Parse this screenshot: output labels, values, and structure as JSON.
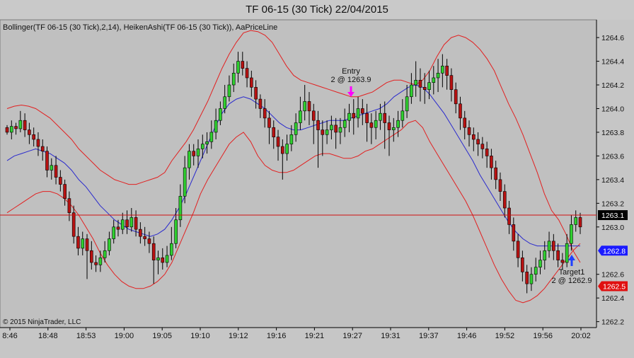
{
  "window_title": "TF 06-15 (30 Tick)  22/04/2015",
  "indicator_legend": "Bollinger(TF 06-15 (30 Tick),2,14), HeikenAshi(TF 06-15 (30 Tick)), AaPriceLine",
  "copyright": "© 2015 NinjaTrader, LLC",
  "colors": {
    "background": "#c0c0c0",
    "candle_up": "#2fcf2f",
    "candle_down": "#b81212",
    "bollinger_band": "#e22020",
    "bollinger_mid": "#2a2acd",
    "price_line": "#d01010",
    "entry_marker": "#ff00ff",
    "target_marker": "#2040ff"
  },
  "chart_data": {
    "type": "candlestick",
    "title": "TF 06-15 (30 Tick)  22/04/2015",
    "ylim": [
      1262.15,
      1264.75
    ],
    "y_ticks": [
      "1264.6",
      "1264.4",
      "1264.2",
      "1264.0",
      "1263.8",
      "1263.6",
      "1263.4",
      "1263.2",
      "1263.0",
      "1262.6",
      "1262.4",
      "1262.2"
    ],
    "x_ticks": [
      "8:46",
      "18:48",
      "18:53",
      "19:00",
      "19:05",
      "19:10",
      "19:12",
      "19:16",
      "19:21",
      "19:27",
      "19:31",
      "19:37",
      "19:46",
      "19:52",
      "19:56",
      "20:02"
    ],
    "price_line": {
      "value": 1263.1,
      "label": "1263.1"
    },
    "price_markers": [
      {
        "label": "1262.8",
        "value": 1262.8,
        "color": "#1a1aff"
      },
      {
        "label": "1262.5",
        "value": 1262.5,
        "color": "#e01010"
      }
    ],
    "annotations": [
      {
        "name": "Entry",
        "text": "2 @ 1263.9",
        "x": "19:27",
        "price": 1263.9
      },
      {
        "name": "Target1",
        "text": "2 @ 1262.9",
        "x": "20:01",
        "price": 1262.9
      }
    ],
    "candles": [
      [
        1263.84,
        1263.8,
        1263.78,
        1263.86
      ],
      [
        1263.8,
        1263.85,
        1263.74,
        1263.9
      ],
      [
        1263.85,
        1263.83,
        1263.78,
        1263.88
      ],
      [
        1263.83,
        1263.9,
        1263.8,
        1263.98
      ],
      [
        1263.9,
        1263.82,
        1263.76,
        1263.96
      ],
      [
        1263.82,
        1263.78,
        1263.7,
        1263.88
      ],
      [
        1263.78,
        1263.74,
        1263.68,
        1263.84
      ],
      [
        1263.74,
        1263.68,
        1263.6,
        1263.8
      ],
      [
        1263.68,
        1263.64,
        1263.56,
        1263.74
      ],
      [
        1263.64,
        1263.48,
        1263.42,
        1263.68
      ],
      [
        1263.48,
        1263.52,
        1263.4,
        1263.58
      ],
      [
        1263.52,
        1263.42,
        1263.36,
        1263.6
      ],
      [
        1263.42,
        1263.36,
        1263.3,
        1263.48
      ],
      [
        1263.36,
        1263.24,
        1263.18,
        1263.4
      ],
      [
        1263.24,
        1263.12,
        1263.05,
        1263.3
      ],
      [
        1263.12,
        1262.92,
        1262.86,
        1263.18
      ],
      [
        1262.92,
        1262.82,
        1262.76,
        1263.0
      ],
      [
        1262.82,
        1262.9,
        1262.76,
        1262.96
      ],
      [
        1262.9,
        1262.8,
        1262.56,
        1262.94
      ],
      [
        1262.8,
        1262.7,
        1262.64,
        1262.88
      ],
      [
        1262.7,
        1262.68,
        1262.62,
        1262.76
      ],
      [
        1262.68,
        1262.74,
        1262.62,
        1262.8
      ],
      [
        1262.74,
        1262.8,
        1262.7,
        1262.88
      ],
      [
        1262.8,
        1262.9,
        1262.76,
        1262.96
      ],
      [
        1262.9,
        1263.0,
        1262.86,
        1263.06
      ],
      [
        1263.0,
        1262.98,
        1262.92,
        1263.06
      ],
      [
        1262.98,
        1263.06,
        1262.94,
        1263.12
      ],
      [
        1263.06,
        1263.0,
        1262.94,
        1263.14
      ],
      [
        1263.0,
        1263.08,
        1262.96,
        1263.16
      ],
      [
        1263.08,
        1262.98,
        1262.92,
        1263.14
      ],
      [
        1262.98,
        1262.92,
        1262.86,
        1263.04
      ],
      [
        1262.92,
        1262.9,
        1262.84,
        1263.0
      ],
      [
        1262.9,
        1262.86,
        1262.78,
        1262.96
      ],
      [
        1262.86,
        1262.72,
        1262.52,
        1262.92
      ],
      [
        1262.72,
        1262.74,
        1262.6,
        1262.8
      ],
      [
        1262.74,
        1262.7,
        1262.64,
        1262.82
      ],
      [
        1262.7,
        1262.76,
        1262.66,
        1262.84
      ],
      [
        1262.76,
        1262.86,
        1262.72,
        1263.0
      ],
      [
        1262.86,
        1263.06,
        1262.82,
        1263.16
      ],
      [
        1263.06,
        1263.26,
        1263.0,
        1263.36
      ],
      [
        1263.26,
        1263.5,
        1263.2,
        1263.6
      ],
      [
        1263.5,
        1263.64,
        1263.4,
        1263.7
      ],
      [
        1263.64,
        1263.6,
        1263.52,
        1263.7
      ],
      [
        1263.6,
        1263.66,
        1263.5,
        1263.74
      ],
      [
        1263.66,
        1263.7,
        1263.58,
        1263.78
      ],
      [
        1263.7,
        1263.72,
        1263.62,
        1263.8
      ],
      [
        1263.72,
        1263.8,
        1263.66,
        1263.9
      ],
      [
        1263.8,
        1263.9,
        1263.74,
        1264.0
      ],
      [
        1263.9,
        1264.0,
        1263.86,
        1264.06
      ],
      [
        1264.0,
        1264.1,
        1263.96,
        1264.2
      ],
      [
        1264.1,
        1264.2,
        1264.06,
        1264.28
      ],
      [
        1264.2,
        1264.3,
        1264.14,
        1264.38
      ],
      [
        1264.3,
        1264.4,
        1264.22,
        1264.48
      ],
      [
        1264.4,
        1264.34,
        1264.28,
        1264.48
      ],
      [
        1264.34,
        1264.26,
        1264.18,
        1264.4
      ],
      [
        1264.26,
        1264.18,
        1264.1,
        1264.32
      ],
      [
        1264.18,
        1264.08,
        1264.0,
        1264.24
      ],
      [
        1264.08,
        1264.0,
        1263.92,
        1264.12
      ],
      [
        1264.0,
        1263.92,
        1263.84,
        1264.08
      ],
      [
        1263.92,
        1263.84,
        1263.7,
        1263.98
      ],
      [
        1263.84,
        1263.76,
        1263.66,
        1263.9
      ],
      [
        1263.76,
        1263.68,
        1263.56,
        1263.82
      ],
      [
        1263.68,
        1263.62,
        1263.4,
        1263.74
      ],
      [
        1263.62,
        1263.7,
        1263.56,
        1263.78
      ],
      [
        1263.7,
        1263.78,
        1263.64,
        1263.86
      ],
      [
        1263.78,
        1263.88,
        1263.72,
        1263.96
      ],
      [
        1263.88,
        1263.98,
        1263.82,
        1264.1
      ],
      [
        1263.98,
        1264.06,
        1263.9,
        1264.2
      ],
      [
        1264.06,
        1263.98,
        1263.86,
        1264.14
      ],
      [
        1263.98,
        1263.9,
        1263.7,
        1264.04
      ],
      [
        1263.9,
        1263.82,
        1263.5,
        1263.98
      ],
      [
        1263.82,
        1263.78,
        1263.6,
        1263.9
      ],
      [
        1263.78,
        1263.82,
        1263.7,
        1263.9
      ],
      [
        1263.82,
        1263.86,
        1263.74,
        1263.94
      ],
      [
        1263.86,
        1263.8,
        1263.66,
        1263.92
      ],
      [
        1263.8,
        1263.84,
        1263.7,
        1263.92
      ],
      [
        1263.84,
        1263.9,
        1263.76,
        1264.0
      ],
      [
        1263.9,
        1263.96,
        1263.8,
        1264.04
      ],
      [
        1263.96,
        1263.92,
        1263.78,
        1264.08
      ],
      [
        1263.92,
        1264.0,
        1263.84,
        1264.1
      ],
      [
        1264.0,
        1263.96,
        1263.86,
        1264.08
      ],
      [
        1263.96,
        1263.88,
        1263.72,
        1264.04
      ],
      [
        1263.88,
        1263.84,
        1263.7,
        1263.96
      ],
      [
        1263.84,
        1263.9,
        1263.74,
        1263.98
      ],
      [
        1263.9,
        1263.96,
        1263.82,
        1264.04
      ],
      [
        1263.96,
        1263.88,
        1263.66,
        1264.06
      ],
      [
        1263.88,
        1263.82,
        1263.6,
        1263.94
      ],
      [
        1263.82,
        1263.84,
        1263.72,
        1263.92
      ],
      [
        1263.84,
        1263.9,
        1263.76,
        1263.98
      ],
      [
        1263.9,
        1263.98,
        1263.84,
        1264.08
      ],
      [
        1263.98,
        1264.1,
        1263.92,
        1264.2
      ],
      [
        1264.1,
        1264.2,
        1264.04,
        1264.3
      ],
      [
        1264.2,
        1264.24,
        1264.1,
        1264.4
      ],
      [
        1264.24,
        1264.18,
        1264.06,
        1264.34
      ],
      [
        1264.18,
        1264.16,
        1264.04,
        1264.3
      ],
      [
        1264.16,
        1264.22,
        1264.08,
        1264.32
      ],
      [
        1264.22,
        1264.26,
        1264.12,
        1264.36
      ],
      [
        1264.26,
        1264.3,
        1264.14,
        1264.42
      ],
      [
        1264.3,
        1264.36,
        1264.18,
        1264.46
      ],
      [
        1264.36,
        1264.28,
        1264.16,
        1264.42
      ],
      [
        1264.28,
        1264.16,
        1264.06,
        1264.34
      ],
      [
        1264.16,
        1264.04,
        1263.96,
        1264.22
      ],
      [
        1264.04,
        1263.92,
        1263.82,
        1264.1
      ],
      [
        1263.92,
        1263.84,
        1263.74,
        1263.98
      ],
      [
        1263.84,
        1263.78,
        1263.68,
        1263.9
      ],
      [
        1263.78,
        1263.74,
        1263.64,
        1263.84
      ],
      [
        1263.74,
        1263.7,
        1263.6,
        1263.8
      ],
      [
        1263.7,
        1263.66,
        1263.58,
        1263.76
      ],
      [
        1263.66,
        1263.6,
        1263.5,
        1263.72
      ],
      [
        1263.6,
        1263.5,
        1263.4,
        1263.66
      ],
      [
        1263.5,
        1263.4,
        1263.32,
        1263.56
      ],
      [
        1263.4,
        1263.3,
        1263.22,
        1263.46
      ],
      [
        1263.3,
        1263.16,
        1263.08,
        1263.36
      ],
      [
        1263.16,
        1263.02,
        1262.94,
        1263.22
      ],
      [
        1263.02,
        1262.88,
        1262.8,
        1263.08
      ],
      [
        1262.88,
        1262.74,
        1262.66,
        1262.94
      ],
      [
        1262.74,
        1262.62,
        1262.54,
        1262.8
      ],
      [
        1262.62,
        1262.52,
        1262.44,
        1262.68
      ],
      [
        1262.52,
        1262.6,
        1262.46,
        1262.66
      ],
      [
        1262.6,
        1262.66,
        1262.54,
        1262.74
      ],
      [
        1262.66,
        1262.72,
        1262.6,
        1262.8
      ],
      [
        1262.72,
        1262.8,
        1262.64,
        1262.88
      ],
      [
        1262.8,
        1262.88,
        1262.74,
        1262.96
      ],
      [
        1262.88,
        1262.8,
        1262.72,
        1262.94
      ],
      [
        1262.8,
        1262.72,
        1262.66,
        1262.86
      ],
      [
        1262.72,
        1262.7,
        1262.64,
        1262.78
      ],
      [
        1262.7,
        1262.86,
        1262.66,
        1262.94
      ],
      [
        1262.86,
        1263.02,
        1262.8,
        1263.1
      ],
      [
        1263.02,
        1263.08,
        1262.96,
        1263.14
      ],
      [
        1263.08,
        1263.0,
        1262.94,
        1263.12
      ]
    ],
    "bollinger": {
      "period": 14,
      "stddev": 2,
      "upper": [
        1264.0,
        1264.02,
        1264.03,
        1264.02,
        1264.0,
        1263.96,
        1263.92,
        1263.86,
        1263.8,
        1263.74,
        1263.66,
        1263.6,
        1263.54,
        1263.48,
        1263.44,
        1263.4,
        1263.38,
        1263.36,
        1263.36,
        1263.38,
        1263.4,
        1263.42,
        1263.46,
        1263.56,
        1263.64,
        1263.72,
        1263.82,
        1263.94,
        1264.06,
        1264.2,
        1264.34,
        1264.46,
        1264.56,
        1264.64,
        1264.66,
        1264.65,
        1264.62,
        1264.56,
        1264.46,
        1264.36,
        1264.28,
        1264.24,
        1264.22,
        1264.2,
        1264.18,
        1264.16,
        1264.14,
        1264.12,
        1264.1,
        1264.1,
        1264.12,
        1264.14,
        1264.18,
        1264.22,
        1264.24,
        1264.24,
        1264.22,
        1264.2,
        1264.24,
        1264.32,
        1264.44,
        1264.54,
        1264.6,
        1264.62,
        1264.6,
        1264.56,
        1264.5,
        1264.42,
        1264.32,
        1264.18,
        1264.04,
        1263.92,
        1263.78,
        1263.62,
        1263.46,
        1263.28,
        1263.14,
        1263.06,
        1262.94,
        1262.8,
        1262.7
      ],
      "mid": [
        1263.56,
        1263.6,
        1263.62,
        1263.64,
        1263.66,
        1263.64,
        1263.62,
        1263.58,
        1263.54,
        1263.48,
        1263.4,
        1263.34,
        1263.26,
        1263.18,
        1263.12,
        1263.06,
        1263.02,
        1262.98,
        1262.96,
        1262.94,
        1262.92,
        1262.94,
        1262.98,
        1263.06,
        1263.16,
        1263.28,
        1263.42,
        1263.56,
        1263.7,
        1263.84,
        1263.96,
        1264.04,
        1264.08,
        1264.1,
        1264.08,
        1264.04,
        1264.0,
        1263.94,
        1263.88,
        1263.84,
        1263.82,
        1263.82,
        1263.84,
        1263.86,
        1263.88,
        1263.9,
        1263.9,
        1263.9,
        1263.92,
        1263.94,
        1263.96,
        1263.98,
        1264.0,
        1264.04,
        1264.1,
        1264.14,
        1264.18,
        1264.2,
        1264.18,
        1264.12,
        1264.04,
        1263.96,
        1263.86,
        1263.76,
        1263.66,
        1263.56,
        1263.44,
        1263.34,
        1263.24,
        1263.14,
        1263.04,
        1262.96,
        1262.9,
        1262.86,
        1262.84,
        1262.84,
        1262.84,
        1262.84,
        1262.84,
        1262.84,
        1262.84
      ],
      "lower": [
        1263.12,
        1263.16,
        1263.2,
        1263.24,
        1263.28,
        1263.3,
        1263.3,
        1263.28,
        1263.24,
        1263.18,
        1263.1,
        1263.0,
        1262.9,
        1262.78,
        1262.68,
        1262.6,
        1262.54,
        1262.5,
        1262.48,
        1262.48,
        1262.5,
        1262.54,
        1262.6,
        1262.7,
        1262.84,
        1262.98,
        1263.12,
        1263.28,
        1263.4,
        1263.5,
        1263.6,
        1263.7,
        1263.76,
        1263.8,
        1263.72,
        1263.6,
        1263.52,
        1263.48,
        1263.46,
        1263.46,
        1263.48,
        1263.52,
        1263.56,
        1263.6,
        1263.62,
        1263.62,
        1263.6,
        1263.58,
        1263.58,
        1263.6,
        1263.64,
        1263.66,
        1263.7,
        1263.74,
        1263.78,
        1263.82,
        1263.88,
        1263.9,
        1263.84,
        1263.72,
        1263.62,
        1263.52,
        1263.42,
        1263.32,
        1263.22,
        1263.1,
        1262.96,
        1262.82,
        1262.68,
        1262.56,
        1262.46,
        1262.38,
        1262.36,
        1262.38,
        1262.42,
        1262.48,
        1262.56,
        1262.64,
        1262.72,
        1262.8,
        1262.86
      ]
    }
  }
}
